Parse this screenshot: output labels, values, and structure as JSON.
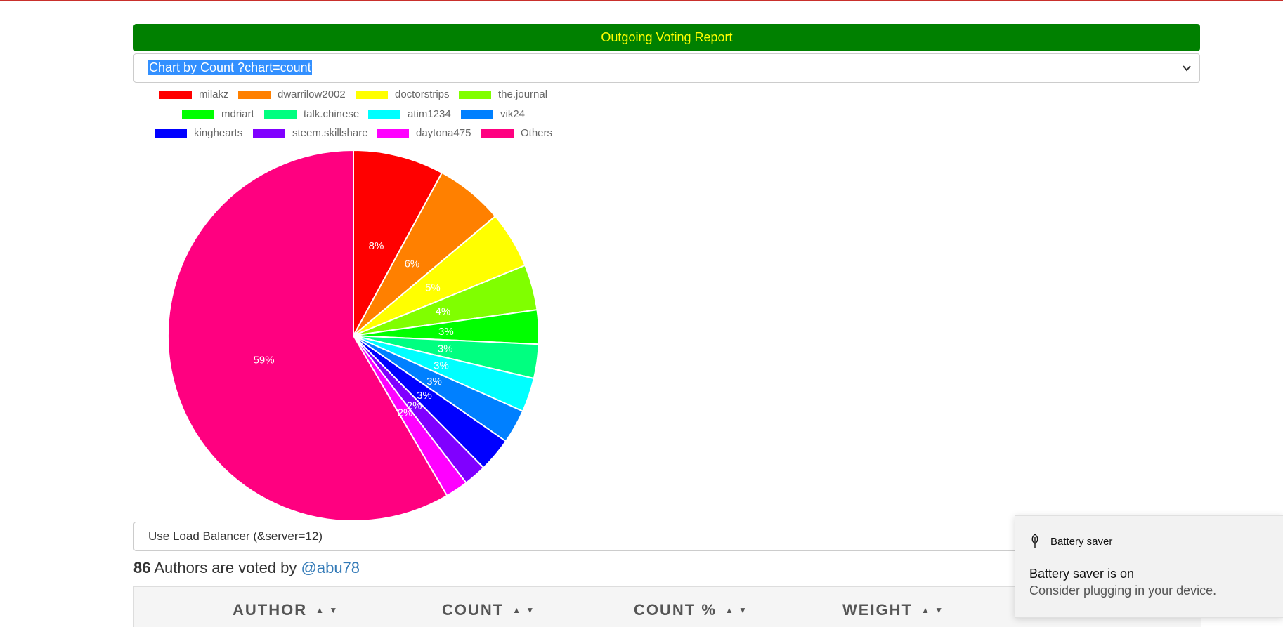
{
  "report": {
    "title": "Outgoing Voting Report"
  },
  "chart_select": {
    "selected": "Chart by Count ?chart=count"
  },
  "legend": [
    {
      "label": "milakz",
      "color": "#ff0000"
    },
    {
      "label": "dwarrilow2002",
      "color": "#ff8000"
    },
    {
      "label": "doctorstrips",
      "color": "#ffff00"
    },
    {
      "label": "the.journal",
      "color": "#80ff00"
    },
    {
      "label": "mdriart",
      "color": "#00ff00"
    },
    {
      "label": "talk.chinese",
      "color": "#00ff80"
    },
    {
      "label": "atim1234",
      "color": "#00ffff"
    },
    {
      "label": "vik24",
      "color": "#0080ff"
    },
    {
      "label": "kinghearts",
      "color": "#0000ff"
    },
    {
      "label": "steem.skillshare",
      "color": "#8000ff"
    },
    {
      "label": "daytona475",
      "color": "#ff00ff"
    },
    {
      "label": "Others",
      "color": "#ff0080"
    }
  ],
  "chart_data": {
    "type": "pie",
    "title": "",
    "categories": [
      "milakz",
      "dwarrilow2002",
      "doctorstrips",
      "the.journal",
      "mdriart",
      "talk.chinese",
      "atim1234",
      "vik24",
      "kinghearts",
      "steem.skillshare",
      "daytona475",
      "Others"
    ],
    "values": [
      8,
      6,
      5,
      4,
      3,
      3,
      3,
      3,
      3,
      2,
      2,
      59
    ],
    "labels": [
      "8%",
      "6%",
      "5%",
      "4%",
      "3%",
      "3%",
      "3%",
      "3%",
      "3%",
      "2%",
      "2%",
      "59%"
    ],
    "colors": [
      "#ff0000",
      "#ff8000",
      "#ffff00",
      "#80ff00",
      "#00ff00",
      "#00ff80",
      "#00ffff",
      "#0080ff",
      "#0000ff",
      "#8000ff",
      "#ff00ff",
      "#ff0080"
    ],
    "legend_position": "top"
  },
  "server_select": {
    "selected": "Use Load Balancer (&server=12)"
  },
  "authors": {
    "count": "86",
    "text": " Authors are voted by ",
    "user": "@abu78"
  },
  "table": {
    "columns": [
      "AUTHOR",
      "COUNT",
      "COUNT %",
      "WEIGHT"
    ],
    "sort_arrows": "▲ ▼"
  },
  "toast": {
    "app": "Battery saver",
    "title": "Battery saver is on",
    "body": "Consider plugging in your device.",
    "icon": "leaf-icon"
  }
}
